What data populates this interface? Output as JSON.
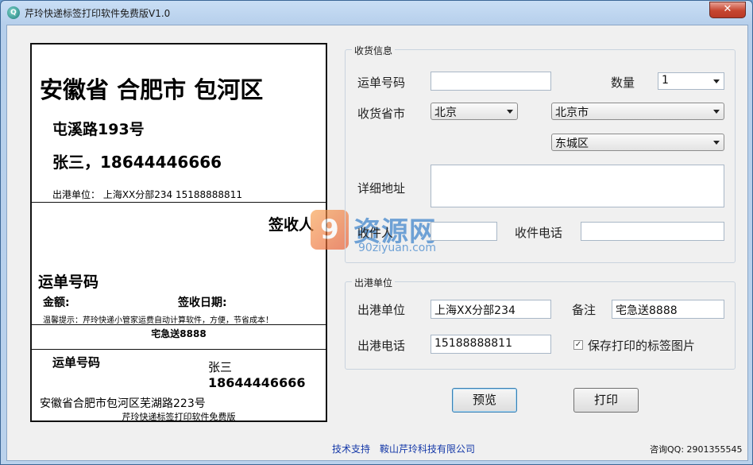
{
  "window": {
    "title": "芹玲快递标签打印软件免费版V1.0",
    "icon": "app-logo-icon",
    "close_glyph": "✕"
  },
  "label": {
    "big_address": "安徽省 合肥市 包河区",
    "street": "屯溪路193号",
    "name_phone": "张三，18644446666",
    "sender_line": "出港单位：  上海XX分部234  15188888811",
    "signer": "签收人",
    "waybill_title": "运单号码",
    "amount": "金额:",
    "sign_date": "签收日期:",
    "tip": "温馨提示：芹玲快递小管家运费自动计算软件，方便，节省成本！",
    "note": "宅急送8888",
    "stub_waybill": "运单号码",
    "stub_name": "张三",
    "stub_phone": "18644446666",
    "stub_address": "安徽省合肥市包河区芜湖路223号",
    "footer": "芹玲快递标签打印软件免费版"
  },
  "watermark": {
    "main": "资源网",
    "sub": "90ziyuan.com",
    "mark": "9"
  },
  "receiver": {
    "group_title": "收货信息",
    "waybill_label": "运单号码",
    "waybill_value": "",
    "quantity_label": "数量",
    "quantity_value": "1",
    "province_city_label": "收货省市",
    "province": "北京",
    "city": "北京市",
    "district": "东城区",
    "address_label": "详细地址",
    "address_value": "",
    "name_label": "收件人",
    "name_value": "",
    "phone_label": "收件电话",
    "phone_value": ""
  },
  "sender": {
    "group_title": "出港单位",
    "unit_label": "出港单位",
    "unit_value": "上海XX分部234",
    "remark_label": "备注",
    "remark_value": "宅急送8888",
    "phone_label": "出港电话",
    "phone_value": "15188888811",
    "save_image_label": "保存打印的标签图片",
    "save_image_checked": true
  },
  "buttons": {
    "preview": "预览",
    "print": "打印"
  },
  "footer": {
    "support": "技术支持",
    "company": "鞍山芹玲科技有限公司",
    "qq": "咨询QQ: 2901355545"
  }
}
